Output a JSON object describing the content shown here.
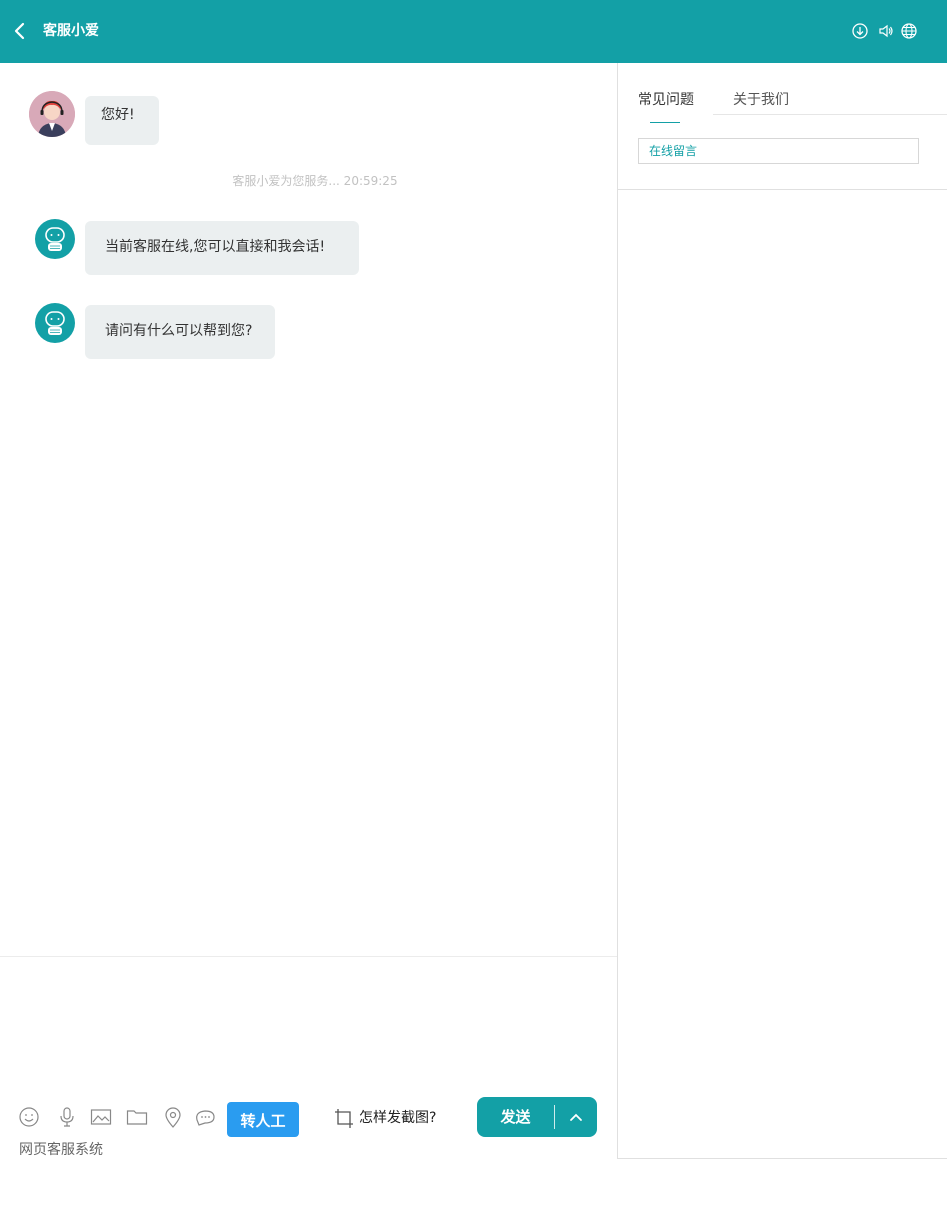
{
  "header": {
    "title": "客服小爱",
    "icons": [
      "back-icon",
      "download-icon",
      "volume-icon",
      "globe-icon"
    ],
    "bg_color": "#13a0a6"
  },
  "chat": {
    "messages": [
      {
        "sender": "agent",
        "avatar": "agent-avatar",
        "text": "您好!"
      },
      {
        "sender": "bot",
        "avatar": "robot-avatar",
        "text": "当前客服在线,您可以直接和我会话!"
      },
      {
        "sender": "bot",
        "avatar": "robot-avatar",
        "text": "请问有什么可以帮到您?"
      }
    ],
    "system_notice": "客服小爱为您服务...  20:59:25"
  },
  "sidebar": {
    "tabs": [
      {
        "label": "常见问题",
        "active": true
      },
      {
        "label": "关于我们",
        "active": false
      }
    ],
    "leave_message": "在线留言"
  },
  "toolbar": {
    "icons": [
      "emoji-icon",
      "microphone-icon",
      "image-icon",
      "folder-icon",
      "location-icon",
      "chat-bubble-icon"
    ],
    "transfer_label": "转人工",
    "screenshot_help": "怎样发截图?",
    "send_label": "发送"
  },
  "footer": {
    "text": "网页客服系统"
  }
}
